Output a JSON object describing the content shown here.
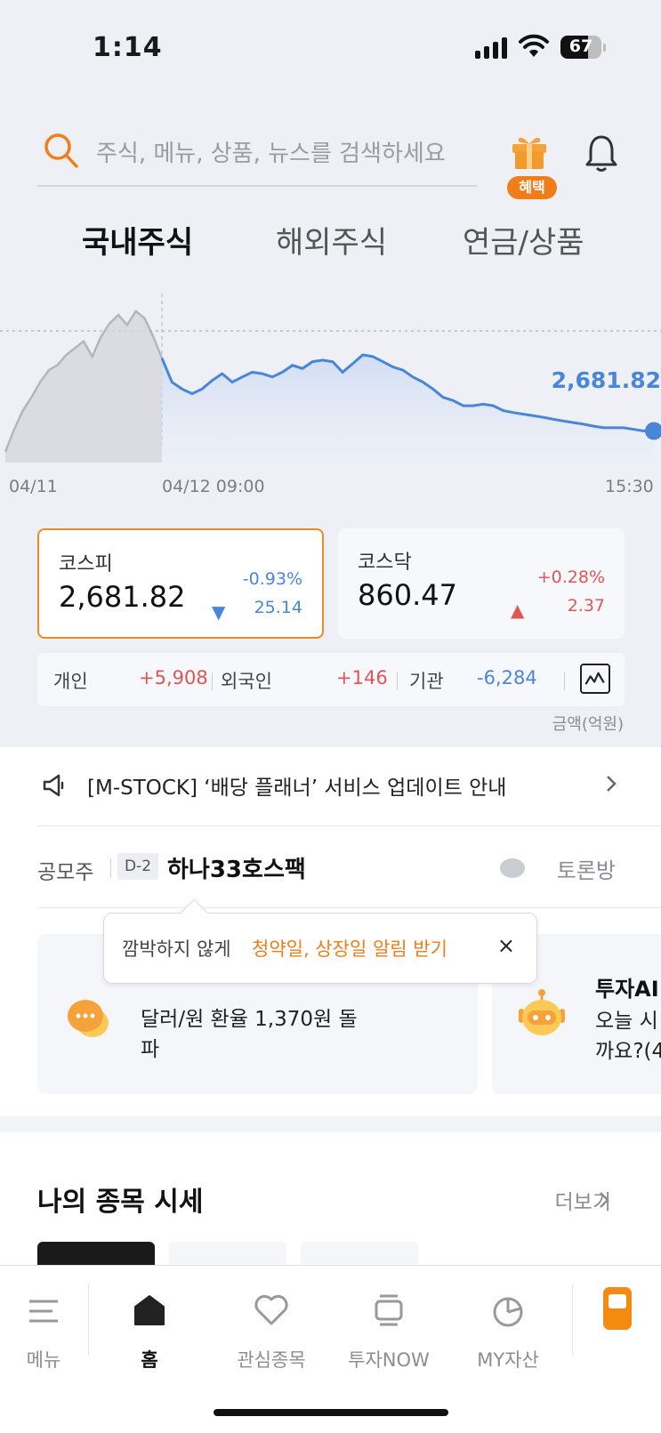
{
  "status_bar": {
    "time": "1:14",
    "battery": "67",
    "battery_level": 0.67
  },
  "search": {
    "placeholder": "주식, 메뉴, 상품, 뉴스를 검색하세요"
  },
  "header": {
    "gift_badge": "혜택"
  },
  "tabs": [
    {
      "label": "국내주식",
      "active": true
    },
    {
      "label": "해외주식",
      "active": false
    },
    {
      "label": "연금/상품",
      "active": false
    }
  ],
  "chart_data": {
    "type": "line",
    "x_labels": [
      "04/11",
      "04/12 09:00",
      "15:30"
    ],
    "last_price_label": "2,681.82",
    "series": [
      {
        "values": [
          2676.8,
          2682.3,
          2687.1,
          2690.4,
          2694.2,
          2697.2,
          2698.5,
          2701.0,
          2702.7,
          2704.4,
          2700.6,
          2705.6,
          2708.9,
          2711.0,
          2708.5,
          2711.9,
          2710.2,
          2705.6,
          2700.2
        ]
      },
      {
        "values": [
          2700.2,
          2694.2,
          2692.5,
          2691.3,
          2692.5,
          2694.6,
          2696.3,
          2694.2,
          2695.5,
          2696.7,
          2696.3,
          2695.5,
          2696.7,
          2698.4,
          2697.6,
          2699.3,
          2699.7,
          2699.3,
          2696.7,
          2698.8,
          2701.0,
          2700.6,
          2699.3,
          2698.0,
          2697.2,
          2695.5,
          2694.2,
          2692.5,
          2690.4,
          2689.6,
          2688.3,
          2688.3,
          2688.7,
          2688.3,
          2687.1,
          2686.6,
          2686.2,
          2685.8,
          2685.4,
          2684.9,
          2684.5,
          2684.1,
          2683.7,
          2683.2,
          2682.8,
          2682.8,
          2682.8,
          2682.4,
          2682.0,
          2682.0
        ]
      }
    ]
  },
  "indices": [
    {
      "name": "코스피",
      "value": "2,681.82",
      "pct": "-0.93%",
      "diff": "25.14",
      "direction": "down",
      "arrow": "▼"
    },
    {
      "name": "코스닥",
      "value": "860.47",
      "pct": "+0.28%",
      "diff": "2.37",
      "direction": "up",
      "arrow": "▲"
    }
  ],
  "investors": [
    {
      "label": "개인",
      "value": "+5,908"
    },
    {
      "label": "외국인",
      "value": "+146"
    },
    {
      "label": "기관",
      "value": "-6,284"
    }
  ],
  "unit_label": "금액(억원)",
  "notice": {
    "text": "[M-STOCK] ‘배당 플래너’ 서비스 업데이트 안내"
  },
  "ipo": {
    "label": "공모주",
    "dday": "D-2",
    "name": "하나33호스팩",
    "forum": "토론방"
  },
  "tooltip": {
    "prefix": "깜박하지 않게",
    "link": "청약일, 상장일 알림 받기",
    "close": "×"
  },
  "info_cards": [
    {
      "line1": "달러/원 환율 1,370원 돌",
      "line2": "파"
    },
    {
      "title": "투자AI",
      "line1": "오늘 시",
      "line2": "까요?(4"
    }
  ],
  "my_stocks": {
    "title": "나의 종목 시세",
    "more": "더보기"
  },
  "bottom_nav": [
    {
      "label": "메뉴",
      "icon": "menu-icon"
    },
    {
      "label": "홈",
      "icon": "home-icon",
      "active": true
    },
    {
      "label": "관심종목",
      "icon": "heart-icon"
    },
    {
      "label": "투자NOW",
      "icon": "cards-icon"
    },
    {
      "label": "MY자산",
      "icon": "pie-icon"
    }
  ],
  "colors": {
    "accent": "#f07d1a",
    "up": "#e05656",
    "down": "#4a86d8"
  }
}
